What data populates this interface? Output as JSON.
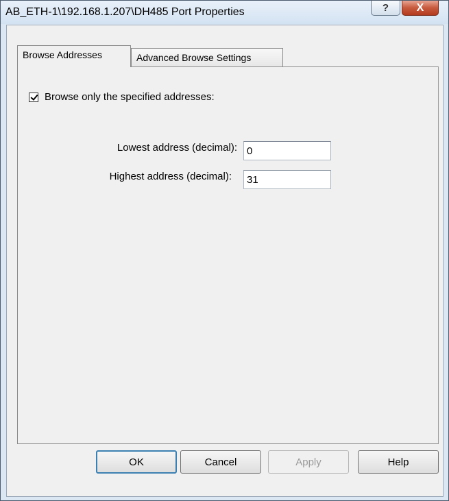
{
  "window": {
    "title": "AB_ETH-1\\192.168.1.207\\DH485 Port Properties",
    "help_glyph": "?",
    "close_glyph": "X"
  },
  "tabs": [
    {
      "label": "Browse Addresses",
      "active": true
    },
    {
      "label": "Advanced Browse Settings",
      "active": false
    }
  ],
  "browse": {
    "only_specified_label": "Browse only the specified addresses:",
    "only_specified_checked": true,
    "lowest_label": "Lowest address (decimal):",
    "lowest_value": "0",
    "highest_label": "Highest address (decimal):",
    "highest_value": "31"
  },
  "buttons": {
    "ok": "OK",
    "cancel": "Cancel",
    "apply": "Apply",
    "help": "Help"
  }
}
